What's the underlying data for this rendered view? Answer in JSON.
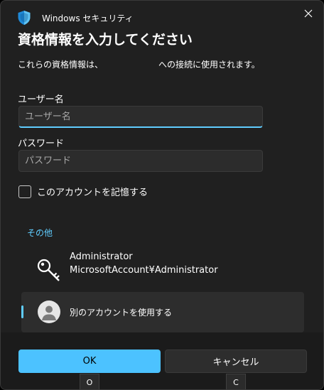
{
  "window": {
    "app_title": "Windows セキュリティ",
    "close_glyph": "✕"
  },
  "heading": "資格情報を入力してください",
  "description": "これらの資格情報は、　　　　　　　への接続に使用されます。",
  "username": {
    "label": "ユーザー名",
    "placeholder": "ユーザー名",
    "value": ""
  },
  "password": {
    "label": "パスワード",
    "placeholder": "パスワード",
    "value": ""
  },
  "remember": {
    "label": "このアカウントを記憶する",
    "checked": false
  },
  "more_choices": "その他",
  "accounts": [
    {
      "icon": "key-icon",
      "name": "Administrator",
      "detail": "MicrosoftAccount¥Administrator"
    },
    {
      "icon": "user-icon",
      "name": "別のアカウントを使用する",
      "selected": true
    }
  ],
  "buttons": {
    "ok": "OK",
    "cancel": "キャンセル"
  },
  "keytips": {
    "ok": "O",
    "cancel": "C"
  },
  "colors": {
    "accent": "#60cdff",
    "primary_button": "#4cc2ff",
    "background": "#202020"
  }
}
